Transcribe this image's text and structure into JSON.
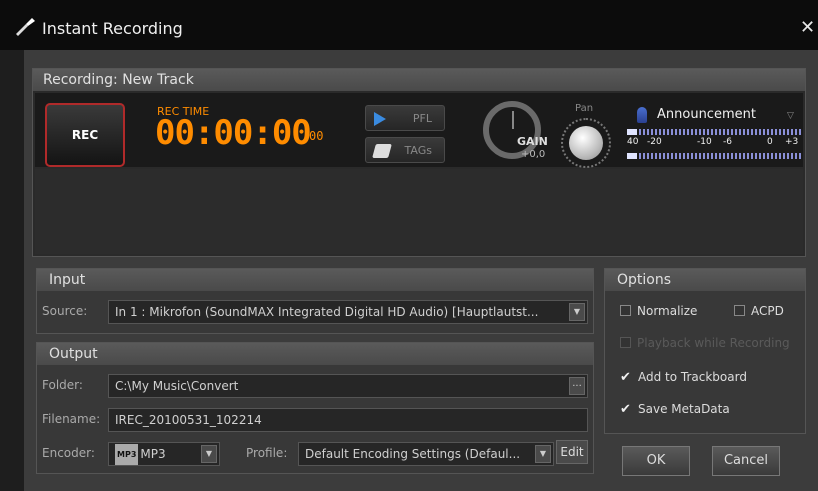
{
  "window": {
    "title": "Instant Recording",
    "close_glyph": "✕"
  },
  "recording": {
    "header": "Recording: New Track",
    "rec_label": "REC",
    "rec_time_label": "REC TIME",
    "rec_time": "00:00:00",
    "frames": "00",
    "pfl_label": "PFL",
    "tags_label": "TAGs",
    "gain_label": "GAIN",
    "gain_value": "+0,0",
    "pan_label": "Pan",
    "channel_name": "Announcement",
    "meter_scale": [
      "40",
      "-20",
      "-10",
      "-6",
      "0",
      "+3"
    ]
  },
  "input": {
    "header": "Input",
    "source_label": "Source:",
    "source_value": "In 1 : Mikrofon (SoundMAX Integrated Digital HD Audio) [Hauptlautst..."
  },
  "output": {
    "header": "Output",
    "folder_label": "Folder:",
    "folder_value": "C:\\My Music\\Convert",
    "folder_browse": "...",
    "filename_label": "Filename:",
    "filename_value": "IREC_20100531_102214",
    "encoder_label": "Encoder:",
    "encoder_badge": "MP3",
    "encoder_value": "MP3",
    "profile_label": "Profile:",
    "profile_value": "Default Encoding Settings (Defaul...",
    "edit_label": "Edit"
  },
  "options": {
    "header": "Options",
    "normalize": "Normalize",
    "acpd": "ACPD",
    "playback": "Playback while Recording",
    "add_trackboard": "Add to Trackboard",
    "save_metadata": "Save MetaData",
    "check_glyph": "✔"
  },
  "buttons": {
    "ok": "OK",
    "cancel": "Cancel"
  },
  "colors": {
    "accent_orange": "#ff8c00",
    "rec_border": "#b02a2a",
    "pfl_blue": "#3a8be0"
  }
}
